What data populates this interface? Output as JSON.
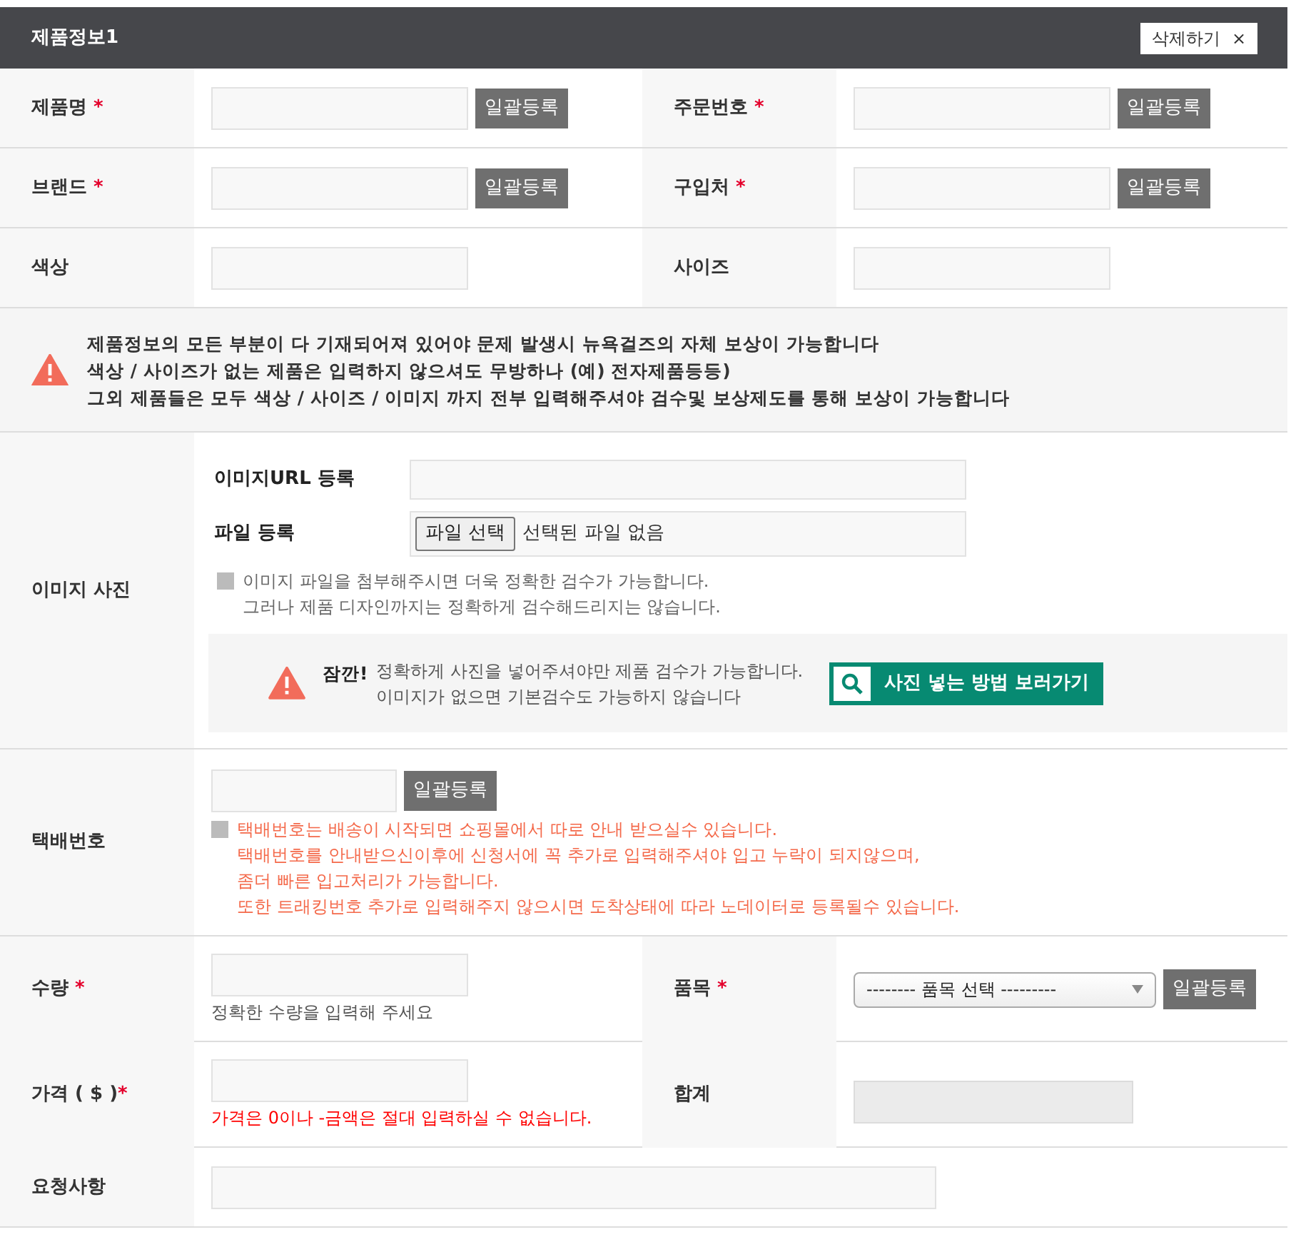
{
  "header": {
    "title": "제품정보1",
    "delete_button": "삭제하기",
    "close_glyph": "×"
  },
  "pair_rows": [
    {
      "cells": [
        {
          "label": "제품명",
          "mark": " *",
          "field": {
            "kind": "input",
            "disabled": false
          },
          "button": "일괄등록"
        },
        {
          "label": "주문번호",
          "mark": " *",
          "field": {
            "kind": "input",
            "disabled": false
          },
          "button": "일괄등록"
        }
      ]
    },
    {
      "cells": [
        {
          "label": "브랜드",
          "mark": " *",
          "field": {
            "kind": "input",
            "disabled": false
          },
          "button": "일괄등록"
        },
        {
          "label": "구입처",
          "mark": " *",
          "field": {
            "kind": "input",
            "disabled": false
          },
          "button": "일괄등록"
        }
      ]
    },
    {
      "cells": [
        {
          "label": "색상",
          "field": {
            "kind": "input",
            "disabled": false
          }
        },
        {
          "label": "사이즈",
          "field": {
            "kind": "input",
            "disabled": false
          }
        }
      ]
    }
  ],
  "notice": {
    "lines": [
      "제품정보의 모든 부분이 다 기재되어져 있어야 문제 발생시 뉴욕걸즈의 자체 보상이 가능합니다",
      "색상 / 사이즈가 없는 제품은 입력하지 않으셔도 무방하나 (예) 전자제품등등)",
      "그외 제품들은 모두 색상 / 사이즈 / 이미지 까지 전부 입력해주셔야 검수및 보상제도를 통해 보상이 가능합니다"
    ]
  },
  "image": {
    "label": "이미지 사진",
    "url_label": "이미지URL 등록",
    "file_label": "파일 등록",
    "file_button": "파일 선택",
    "file_status": "선택된 파일 없음",
    "info_lines": [
      "이미지 파일을 첨부해주시면 더욱 정확한 검수가 가능합니다.",
      "그러나 제품 디자인까지는 정확하게 검수해드리지는 않습니다."
    ],
    "warning": {
      "title": "잠깐!",
      "lines": [
        "정확하게 사진을 넣어주셔야만 제품 검수가 가능합니다.",
        "이미지가 없으면 기본검수도 가능하지 않습니다"
      ],
      "button": "사진 넣는 방법 보러가기"
    }
  },
  "tracking": {
    "label": "택배번호",
    "button": "일괄등록",
    "info_lines": [
      "택배번호는 배송이 시작되면 쇼핑몰에서 따로 안내 받으실수 있습니다.",
      "택배번호를 안내받으신이후에 신청서에 꼭 추가로 입력해주셔야 입고 누락이 되지않으며,",
      "좀더 빠른 입고처리가 가능합니다.",
      "또한 트래킹번호 추가로 입력해주지 않으시면 도착상태에 따라 노데이터로 등록될수 있습니다."
    ]
  },
  "pair_rows_2": [
    {
      "cells": [
        {
          "label": "수량",
          "mark": " *",
          "field": {
            "kind": "input",
            "disabled": false
          },
          "hint": {
            "kind": "note",
            "text": "정확한 수량을 입력해 주세요"
          }
        },
        {
          "label": "품목",
          "mark": " *",
          "field": {
            "kind": "select",
            "value": "-------- 품목 선택 ---------",
            "disabled": false
          },
          "button": "일괄등록"
        }
      ]
    },
    {
      "cells": [
        {
          "label": "가격 ( $ )",
          "mark": "*",
          "field": {
            "kind": "input",
            "disabled": false
          },
          "hint": {
            "kind": "error",
            "text": "가격은 0이나 -금액은 절대 입력하실 수 없습니다."
          }
        },
        {
          "label": "합계",
          "field": {
            "kind": "input",
            "disabled": true
          }
        }
      ]
    }
  ],
  "request": {
    "label": "요청사항"
  }
}
